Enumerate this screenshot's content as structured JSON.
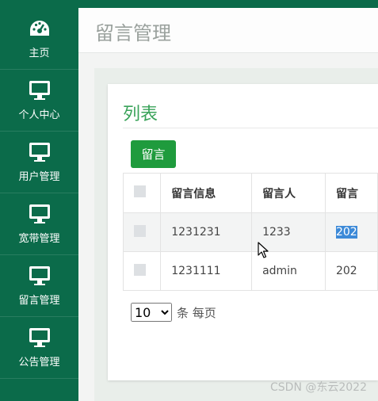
{
  "sidebar": {
    "items": [
      {
        "label": "主页",
        "icon": "dashboard-icon"
      },
      {
        "label": "个人中心",
        "icon": "monitor-icon"
      },
      {
        "label": "用户管理",
        "icon": "monitor-icon"
      },
      {
        "label": "宽带管理",
        "icon": "monitor-icon"
      },
      {
        "label": "留言管理",
        "icon": "monitor-icon"
      },
      {
        "label": "公告管理",
        "icon": "monitor-icon"
      }
    ]
  },
  "header": {
    "title": "留言管理"
  },
  "card": {
    "title": "列表",
    "add_button": "留言"
  },
  "table": {
    "columns": [
      "留言信息",
      "留言人",
      "留言"
    ],
    "rows": [
      {
        "info": "1231231",
        "author": "1233",
        "time": "202"
      },
      {
        "info": "1231111",
        "author": "admin",
        "time": "202"
      }
    ]
  },
  "pager": {
    "page_size": "10",
    "options": [
      "10"
    ],
    "unit_label": "条 每页"
  },
  "watermark": "CSDN @东云2022",
  "colors": {
    "sidebar": "#0b6b4a",
    "accent": "#1f9b3d",
    "title": "#3aa35a",
    "selection": "#3d8ad8"
  }
}
